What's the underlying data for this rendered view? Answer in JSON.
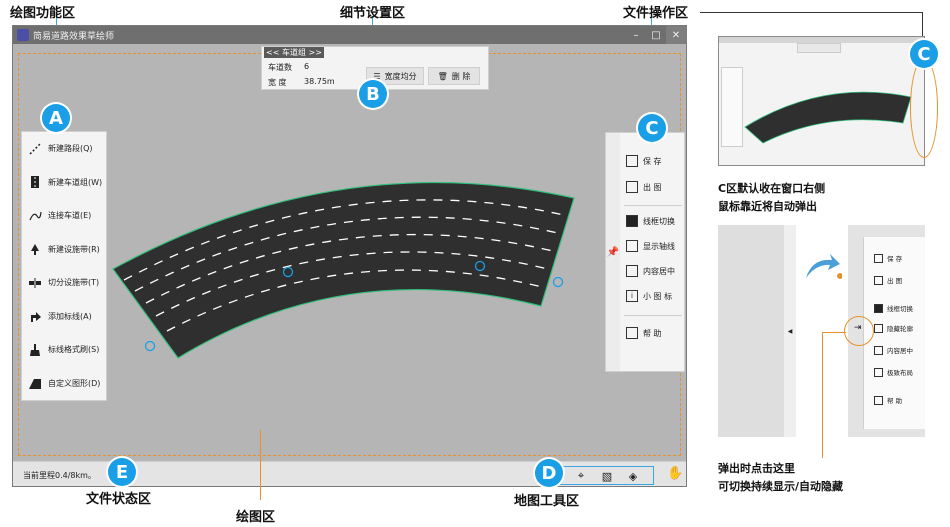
{
  "annotations": {
    "drawing_function_area": "绘图功能区",
    "detail_settings_area": "细节设置区",
    "file_operation_area": "文件操作区",
    "file_status_area": "文件状态区",
    "drawing_area": "绘图区",
    "map_tools_area": "地图工具区",
    "badges": [
      "A",
      "B",
      "C",
      "D",
      "E"
    ]
  },
  "window": {
    "title": "简易道路效果草绘师",
    "controls": [
      "–",
      "□",
      "✕"
    ]
  },
  "left_panel": {
    "items": [
      {
        "label": "新建路段(Q)",
        "icon": "road-segment-icon"
      },
      {
        "label": "新建车道组(W)",
        "icon": "lane-group-icon"
      },
      {
        "label": "连接车道(E)",
        "icon": "connect-lane-icon"
      },
      {
        "label": "新建设施带(R)",
        "icon": "facility-belt-icon"
      },
      {
        "label": "切分设施带(T)",
        "icon": "split-belt-icon"
      },
      {
        "label": "添加标线(A)",
        "icon": "add-marking-icon"
      },
      {
        "label": "标线格式刷(S)",
        "icon": "format-brush-icon"
      },
      {
        "label": "自定义图形(D)",
        "icon": "custom-shape-icon"
      }
    ]
  },
  "detail_panel": {
    "header": "<< 车道组 >>",
    "lane_count_label": "车道数",
    "lane_count_value": "6",
    "width_label": "宽 度",
    "width_value": "38.75m",
    "equal_width_button": "宽度均分",
    "delete_button": "删 除"
  },
  "file_panel": {
    "items": [
      {
        "label": "保 存",
        "icon": "save-icon"
      },
      {
        "label": "出 图",
        "icon": "export-image-icon"
      },
      {
        "label": "线框切换",
        "icon": "wireframe-icon"
      },
      {
        "label": "显示轴线",
        "icon": "axis-icon"
      },
      {
        "label": "内容居中",
        "icon": "center-icon"
      },
      {
        "label": "小 图 标",
        "icon": "small-icon-icon"
      },
      {
        "label": "帮 助",
        "icon": "help-icon"
      }
    ],
    "pin_icon": "pin-icon"
  },
  "status": {
    "mileage": "当前里程0.4/8km。"
  },
  "map_tools": [
    "location-pin-icon",
    "texture-icon",
    "layers-icon",
    "hand-icon"
  ],
  "side_note": {
    "caption_1": "C区默认收在窗口右侧",
    "caption_2": "鼠标靠近将自动弹出",
    "caption_3": "弹出时点击这里",
    "caption_4": "可切换持续显示/自动隐藏",
    "demo_items": [
      {
        "label": "保 存"
      },
      {
        "label": "出 图"
      },
      {
        "label": "线框切换"
      },
      {
        "label": "隐藏轮廓"
      },
      {
        "label": "内容居中"
      },
      {
        "label": "极致布局"
      },
      {
        "label": "帮 助"
      }
    ]
  },
  "colors": {
    "road": "#2f2f2f",
    "road_edge": "#2fbf7a",
    "lane_dash": "#ffffff",
    "callout_orange": "#e8912b",
    "badge_blue": "#1a9fe6",
    "canvas_bg": "#b5b5b5"
  }
}
